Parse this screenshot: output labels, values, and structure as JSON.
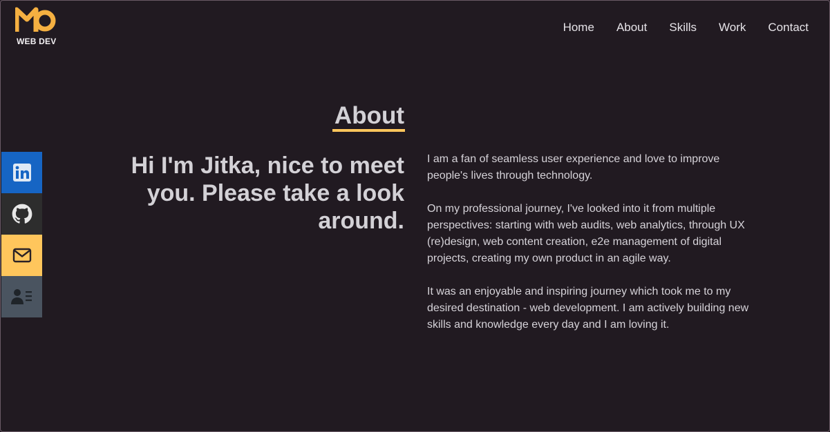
{
  "logo": {
    "mark": "MO",
    "text": "WEB DEV",
    "color": "#f5b041"
  },
  "nav": {
    "items": [
      {
        "label": "Home"
      },
      {
        "label": "About"
      },
      {
        "label": "Skills"
      },
      {
        "label": "Work"
      },
      {
        "label": "Contact"
      }
    ]
  },
  "social": [
    {
      "icon": "linkedin-icon",
      "color": "#1665c4"
    },
    {
      "icon": "github-icon",
      "color": "#2d2d2d"
    },
    {
      "icon": "mail-icon",
      "color": "#ffc65c"
    },
    {
      "icon": "contact-card-icon",
      "color": "#4a5460"
    }
  ],
  "about": {
    "title": "About",
    "accent": "#ffc65c",
    "headline": "Hi I'm Jitka, nice to meet you. Please take a look around.",
    "paragraphs": [
      "I am a fan of seamless user experience and love to improve people's lives through technology.",
      "On my professional journey, I've looked into it from multiple perspectives: starting with web audits, web analytics, through UX (re)design, web content creation, e2e management of digital projects, creating my own product in an agile way.",
      "It was an enjoyable and inspiring journey which took me to my desired destination - web development. I am actively building new skills and knowledge every day and I am loving it."
    ]
  },
  "colors": {
    "background": "#211a21",
    "text": "#d3d1d6"
  }
}
